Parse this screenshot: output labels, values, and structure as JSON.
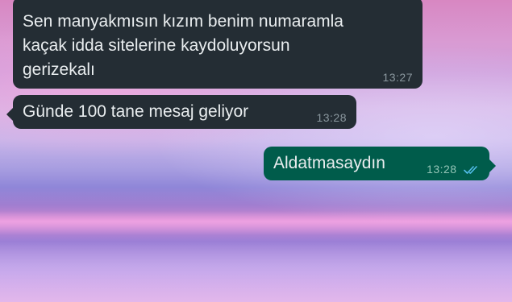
{
  "chat": {
    "messages": [
      {
        "direction": "incoming",
        "text": "Sen manyakmısın kızım benim numaramla\nkaçak idda sitelerine kaydoluyorsun\ngerizekalı",
        "time": "13:27"
      },
      {
        "direction": "incoming",
        "text": "Günde 100 tane mesaj geliyor",
        "time": "13:28"
      },
      {
        "direction": "outgoing",
        "text": "Aldatmasaydın",
        "time": "13:28",
        "status_icon": "double-check-read-icon"
      }
    ]
  },
  "colors": {
    "incoming_bubble": "#242d34",
    "outgoing_bubble": "#005c4b",
    "read_ticks": "#53bdeb",
    "message_text": "#e9edef",
    "timestamp": "#8a979e"
  }
}
